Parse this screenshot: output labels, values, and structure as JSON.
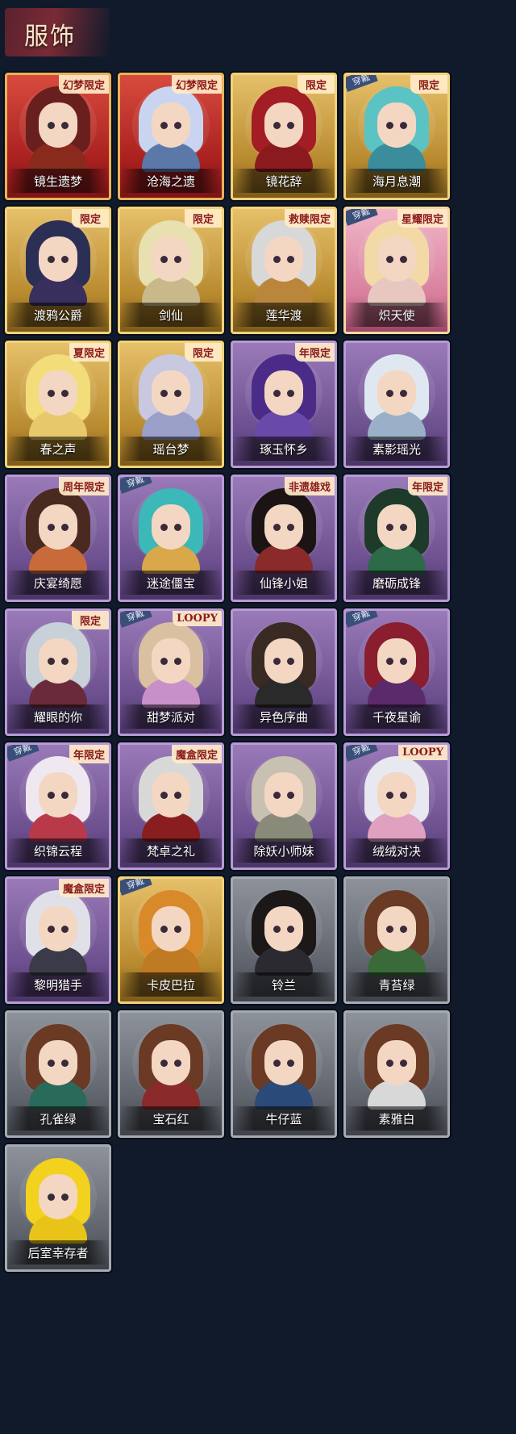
{
  "header": {
    "title": "服饰"
  },
  "outfits": [
    {
      "name": "镜生遗梦",
      "tier": "red",
      "badge": "幻梦限定",
      "worn": false,
      "hair": "#6a1f1f",
      "outfit": "#8a2a1c"
    },
    {
      "name": "沧海之遗",
      "tier": "red",
      "badge": "幻梦限定",
      "worn": false,
      "hair": "#c9d5f0",
      "outfit": "#5b78a8"
    },
    {
      "name": "镜花辞",
      "tier": "gold",
      "badge": "限定",
      "worn": false,
      "hair": "#a21d24",
      "outfit": "#8b1a1f"
    },
    {
      "name": "海月息潮",
      "tier": "gold",
      "badge": "限定",
      "worn": true,
      "hair": "#5bc3c4",
      "outfit": "#3b8d9b"
    },
    {
      "name": "渡鸦公爵",
      "tier": "gold",
      "badge": "限定",
      "worn": false,
      "hair": "#2c2f55",
      "outfit": "#3a2f5c"
    },
    {
      "name": "剑仙",
      "tier": "gold",
      "badge": "限定",
      "worn": false,
      "hair": "#e8e0b0",
      "outfit": "#c9b98a"
    },
    {
      "name": "莲华渡",
      "tier": "gold",
      "badge": "救赎限定",
      "worn": false,
      "hair": "#d8d8d8",
      "outfit": "#b9863c"
    },
    {
      "name": "炽天使",
      "tier": "pink",
      "badge": "星耀限定",
      "worn": true,
      "hair": "#f3d9a6",
      "outfit": "#e8c7c0"
    },
    {
      "name": "春之声",
      "tier": "gold",
      "badge": "夏限定",
      "worn": false,
      "hair": "#f2dd7a",
      "outfit": "#e7c86a"
    },
    {
      "name": "瑶台梦",
      "tier": "gold",
      "badge": "限定",
      "worn": false,
      "hair": "#c8c8e0",
      "outfit": "#9aa0c8"
    },
    {
      "name": "琢玉怀乡",
      "tier": "purple",
      "badge": "年限定",
      "worn": false,
      "hair": "#4a2c88",
      "outfit": "#6a4aa8"
    },
    {
      "name": "素影瑶光",
      "tier": "purple",
      "badge": "",
      "worn": false,
      "hair": "#dfe8f0",
      "outfit": "#9ab0c8"
    },
    {
      "name": "庆宴绮愿",
      "tier": "purple",
      "badge": "周年限定",
      "worn": false,
      "hair": "#4a2a20",
      "outfit": "#c86a3a"
    },
    {
      "name": "迷途僵宝",
      "tier": "purple",
      "badge": "",
      "worn": true,
      "hair": "#3cb8b8",
      "outfit": "#d8a84a"
    },
    {
      "name": "仙锋小姐",
      "tier": "purple",
      "badge": "非遗雄戏",
      "worn": false,
      "hair": "#1c1414",
      "outfit": "#8a2a2a"
    },
    {
      "name": "磨砺成锋",
      "tier": "purple",
      "badge": "年限定",
      "worn": false,
      "hair": "#1e3a2a",
      "outfit": "#2c6a48"
    },
    {
      "name": "耀眼的你",
      "tier": "purple",
      "badge": "限定",
      "worn": false,
      "hair": "#c8d0d8",
      "outfit": "#6a2a3a"
    },
    {
      "name": "甜梦派对",
      "tier": "purple",
      "badge": "LOOPY",
      "worn": true,
      "hair": "#d8c0a0",
      "outfit": "#c890c8"
    },
    {
      "name": "异色序曲",
      "tier": "purple",
      "badge": "",
      "worn": false,
      "hair": "#3a2a24",
      "outfit": "#2a2a2a"
    },
    {
      "name": "千夜星谕",
      "tier": "purple",
      "badge": "",
      "worn": true,
      "hair": "#8a1e2e",
      "outfit": "#5a2a6a"
    },
    {
      "name": "织锦云程",
      "tier": "purple",
      "badge": "年限定",
      "worn": true,
      "hair": "#efe8f0",
      "outfit": "#b83a4a"
    },
    {
      "name": "梵卓之礼",
      "tier": "purple",
      "badge": "魔盒限定",
      "worn": false,
      "hair": "#d8d8d8",
      "outfit": "#8a1e1e"
    },
    {
      "name": "除妖小师妹",
      "tier": "purple",
      "badge": "",
      "worn": false,
      "hair": "#c8c0b0",
      "outfit": "#8a8a7a"
    },
    {
      "name": "绒绒对决",
      "tier": "purple",
      "badge": "LOOPY",
      "worn": true,
      "hair": "#e8e8f0",
      "outfit": "#e0a0c0"
    },
    {
      "name": "黎明猎手",
      "tier": "purple",
      "badge": "魔盒限定",
      "worn": false,
      "hair": "#e0e0e8",
      "outfit": "#3a3a48"
    },
    {
      "name": "卡皮巴拉",
      "tier": "gold",
      "badge": "",
      "worn": true,
      "hair": "#d88a2a",
      "outfit": "#c07a24"
    },
    {
      "name": "铃兰",
      "tier": "gray",
      "badge": "",
      "worn": false,
      "hair": "#1c1818",
      "outfit": "#2a2a30"
    },
    {
      "name": "青苔绿",
      "tier": "gray",
      "badge": "",
      "worn": false,
      "hair": "#6a3a24",
      "outfit": "#3a6a3a"
    },
    {
      "name": "孔雀绿",
      "tier": "gray",
      "badge": "",
      "worn": false,
      "hair": "#6a3a24",
      "outfit": "#2a6a5a"
    },
    {
      "name": "宝石红",
      "tier": "gray",
      "badge": "",
      "worn": false,
      "hair": "#6a3a24",
      "outfit": "#8a2a2a"
    },
    {
      "name": "牛仔蓝",
      "tier": "gray",
      "badge": "",
      "worn": false,
      "hair": "#6a3a24",
      "outfit": "#2a4a7a"
    },
    {
      "name": "素雅白",
      "tier": "gray",
      "badge": "",
      "worn": false,
      "hair": "#6a3a24",
      "outfit": "#d8d8d8"
    },
    {
      "name": "后室幸存者",
      "tier": "gray",
      "badge": "",
      "worn": false,
      "hair": "#f2d21e",
      "outfit": "#e8c418"
    }
  ],
  "labels": {
    "worn": "穿戴"
  }
}
